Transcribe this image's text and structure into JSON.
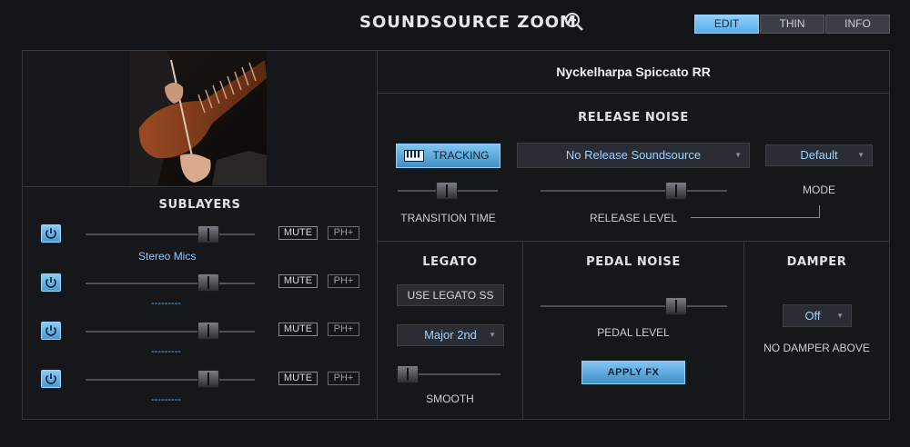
{
  "header": {
    "title": "SOUNDSOURCE ZOOM",
    "tabs": [
      {
        "label": "EDIT"
      },
      {
        "label": "THIN"
      },
      {
        "label": "INFO"
      }
    ]
  },
  "instrument": {
    "name": "Nyckelharpa Spiccato RR"
  },
  "sublayers": {
    "title": "SUBLAYERS",
    "rows": [
      {
        "name": "Stereo Mics",
        "mute": "MUTE",
        "ph": "PH+",
        "level_percent": 73
      },
      {
        "name": "---------",
        "mute": "MUTE",
        "ph": "PH+",
        "level_percent": 73
      },
      {
        "name": "---------",
        "mute": "MUTE",
        "ph": "PH+",
        "level_percent": 73
      },
      {
        "name": "---------",
        "mute": "MUTE",
        "ph": "PH+",
        "level_percent": 73
      }
    ]
  },
  "release_noise": {
    "title": "RELEASE NOISE",
    "tracking_label": "TRACKING",
    "soundsource_dropdown": "No Release Soundsource",
    "mode_dropdown": "Default",
    "transition_time_label": "TRANSITION TIME",
    "release_level_label": "RELEASE LEVEL",
    "mode_label": "MODE",
    "transition_time_percent": 48,
    "release_level_percent": 73
  },
  "legato": {
    "title": "LEGATO",
    "use_legato_label": "USE LEGATO SS",
    "interval_dropdown": "Major 2nd",
    "smooth_label": "SMOOTH",
    "smooth_percent": 5
  },
  "pedal_noise": {
    "title": "PEDAL NOISE",
    "pedal_level_label": "PEDAL LEVEL",
    "apply_fx_label": "APPLY FX",
    "pedal_level_percent": 73
  },
  "damper": {
    "title": "DAMPER",
    "dropdown": "Off",
    "no_damper_label": "NO DAMPER ABOVE"
  },
  "colors": {
    "accent": "#5aaee6",
    "background": "#131417",
    "text_blue": "#9cd2ff"
  }
}
